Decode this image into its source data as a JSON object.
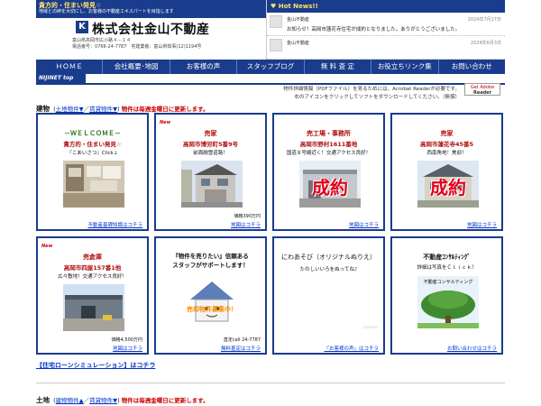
{
  "header": {
    "catch_main": "貴方的・住まい発見☆",
    "catch_sub": "地域との絆を大切にし、お客様の不動産エキスパートを目指します",
    "logo_mark": "K",
    "company": "株式会社金山不動産",
    "addr_line1": "富山県高岡市広小路４－１４",
    "addr_line2": "電話番号：0766-24-7787　宅建業番：富山県知事(12)1194号"
  },
  "news": {
    "title": "♥ Hot News!!",
    "items": [
      {
        "who": "金山不動産",
        "date": "2024年7月17日",
        "msg": "お知らせ！高岡市蓮花寺住宅が成約となりました。ありがとうございました。"
      },
      {
        "who": "金山不動産",
        "date": "2024年6月3日",
        "msg": ""
      }
    ]
  },
  "nav": [
    "ＨＯＭＥ",
    "会社概要･地図",
    "お客様の声",
    "スタッフブログ",
    "無 料 査 定",
    "お役立ちリンク集",
    "お問い合わせ"
  ],
  "subtag": "NIJINET top",
  "acrobat": {
    "text1": "物件詳細情報（PDFファイル）を見るためには、Acrobat Readerが必要です。",
    "text2": "右のアイコンをクリックしてソフトをダウンロードしてください。（無償）",
    "btn_top": "Get Adobe",
    "btn_bottom": "Reader"
  },
  "buildings": {
    "title": "建物",
    "link_land": "土地物件▼",
    "link_rental": "賃貸物件▼",
    "notice": "物件は毎週金曜日に更新します。"
  },
  "cards": [
    {
      "new": "",
      "t1": "－ＷＥＬＣＯＭＥ－",
      "t2": "貴方的・住まい発見☆",
      "t3": "『こあいさつ』Click↓",
      "stamp": "",
      "price": "",
      "link": "不動産基礎知識はコチラ"
    },
    {
      "new": "New",
      "t1": "売家",
      "t2": "高岡市博労町5番9号",
      "t3": "前面融雪道路！",
      "stamp": "",
      "price": "価格390万円",
      "link": "地図はコチラ"
    },
    {
      "new": "",
      "t1": "売工場・事務所",
      "t2": "高岡市野村1611番地",
      "t3": "国道８号線近く！交通アクセス良好！",
      "stamp": "成約",
      "price": "",
      "link": "地図はコチラ"
    },
    {
      "new": "",
      "t1": "売家",
      "t2": "高岡市蓮花寺45番5",
      "t3": "西南角地！美邸！",
      "stamp": "成約",
      "price": "",
      "link": "地図はコチラ"
    },
    {
      "new": "New",
      "t1": "売倉庫",
      "t2": "高岡市四屋157番1他",
      "t3": "広々敷地！交通アクセス良好！",
      "stamp": "",
      "price": "価格4,500万円",
      "link": "地図はコチラ"
    },
    {
      "new": "",
      "t1": "『物件を売りたい』信頼ある",
      "t2": "スタッフがサポートします！",
      "t3": "",
      "stamp": "",
      "price": "直定call 24-7787",
      "link": "無料査定はコチラ"
    },
    {
      "new": "",
      "t1": "にわあそび（オリジナルぬりえ）",
      "t2": "",
      "t3": "たのしいいろをぬってね♪",
      "stamp": "",
      "price": "",
      "link": "『お客様の声』はコチラ"
    },
    {
      "new": "",
      "t1": "不動産ｺﾝｻﾙﾃｨﾝｸﾞ",
      "t2": "",
      "t3": "詳細は写真をＣｌｉｃｋ！",
      "stamp": "",
      "price": "",
      "link": "お問い合わせはコチラ"
    }
  ],
  "sale_sign": "売却物件募集中！",
  "consult_label": "不動産コンサルティング",
  "loan_link": "【住宅ローンシミュレーション】はコチラ",
  "land": {
    "title": "土地",
    "link_building": "建物物件▲",
    "link_rental": "賃貸物件▼",
    "notice": "物件は毎週金曜日に更新します。"
  },
  "colors": {
    "brand": "#1a3c8c",
    "accent": "#b01010",
    "sold": "#e0001b"
  }
}
